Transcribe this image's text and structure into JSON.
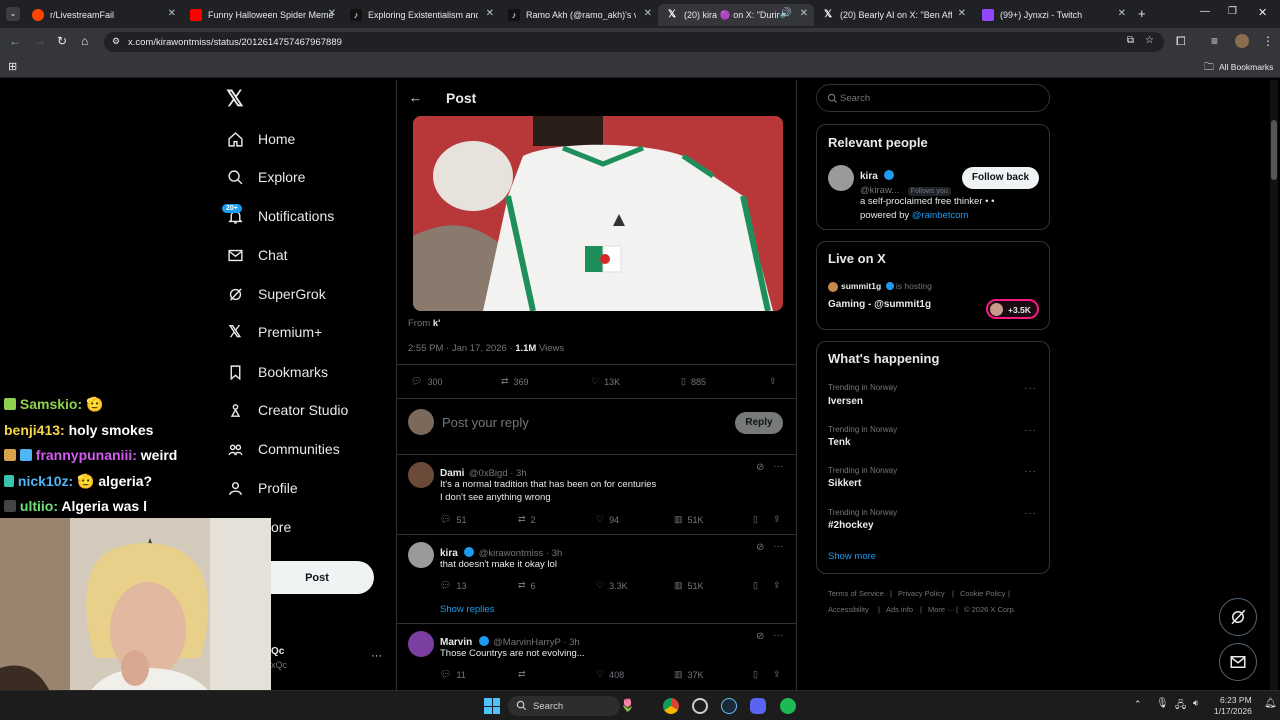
{
  "browser": {
    "tabs": [
      {
        "label": "r/LivestreamFail",
        "color": "#ff4500"
      },
      {
        "label": "Funny Halloween Spider Meme",
        "color": "#ff0000"
      },
      {
        "label": "Exploring Existentialism and Ph",
        "color": "#ffffff"
      },
      {
        "label": "Ramo Akh (@ramo_akh)'s vide",
        "color": "#ffffff"
      },
      {
        "label": "(20) kira 🟣 on X: \"During",
        "color": "#ffffff"
      },
      {
        "label": "(20) Bearly AI on X: \"Ben Affleck",
        "color": "#ffffff"
      },
      {
        "label": "(99+) Jynxzi - Twitch",
        "color": "#9146ff"
      }
    ],
    "url": "x.com/kirawontmiss/status/2012614757467967889",
    "bookmarks_label": "All Bookmarks"
  },
  "nav": {
    "items": [
      {
        "label": "Home",
        "icon": "home-icon"
      },
      {
        "label": "Explore",
        "icon": "search-icon"
      },
      {
        "label": "Notifications",
        "icon": "bell-icon",
        "badge": "20+"
      },
      {
        "label": "Chat",
        "icon": "mail-icon"
      },
      {
        "label": "SuperGrok",
        "icon": "grok-icon"
      },
      {
        "label": "Premium+",
        "icon": "x-logo-icon"
      },
      {
        "label": "Bookmarks",
        "icon": "bookmark-icon"
      },
      {
        "label": "Creator Studio",
        "icon": "creator-icon"
      },
      {
        "label": "Communities",
        "icon": "people-icon"
      },
      {
        "label": "Profile",
        "icon": "person-icon"
      },
      {
        "label": "ore",
        "icon": ""
      }
    ],
    "post_label": "Post",
    "account_fragment": "Qc",
    "account_handle_fragment": "xQc"
  },
  "post": {
    "header_title": "Post",
    "from_label": "From",
    "from_name": "k'",
    "time_line": "2:55 PM · Jan 17, 2026 · ",
    "views_count": "1.1M",
    "views_label": " Views",
    "stats": {
      "replies": "300",
      "reposts": "369",
      "likes": "13K",
      "bookmarks": "885"
    },
    "reply_placeholder": "Post your reply",
    "reply_button": "Reply"
  },
  "replies": [
    {
      "name": "Dami",
      "handle": "@0xBigd · 3h",
      "lines": [
        "It's a normal tradition that has been on for centuries",
        "I don't see anything wrong"
      ],
      "replies": "51",
      "reposts": "2",
      "likes": "94",
      "views": "51K",
      "avatar": "#6b4a3a",
      "verified": false
    },
    {
      "name": "kira",
      "handle": "@kirawontmiss · 3h",
      "lines": [
        "that doesn't make it okay lol"
      ],
      "replies": "13",
      "reposts": "6",
      "likes": "3.3K",
      "views": "51K",
      "avatar": "#9a9a9a",
      "verified": true,
      "show_replies": "Show replies"
    },
    {
      "name": "Marvin",
      "handle": "@MarvinHarryP · 3h",
      "lines": [
        "Those Countrys are not evolving..."
      ],
      "replies": "11",
      "reposts": "",
      "likes": "408",
      "views": "37K",
      "avatar": "#7a3fa0",
      "verified": true
    }
  ],
  "sidebar": {
    "search_placeholder": "Search",
    "relevant": {
      "title": "Relevant people",
      "name": "kira",
      "handle": "@kiraw...",
      "follows_you": "Follows you",
      "follow_button": "Follow back",
      "bio_line1": "a self-proclaimed free thinker • •",
      "bio_prefix": "powered by ",
      "bio_link": "@rainbetcom"
    },
    "live": {
      "title": "Live on X",
      "host": "summit1g",
      "hosting": "is hosting",
      "show": "Gaming - @summit1g",
      "listeners": "+3.5K"
    },
    "happening": {
      "title": "What's happening",
      "trends": [
        {
          "label": "Trending in Norway",
          "name": "Iversen"
        },
        {
          "label": "Trending in Norway",
          "name": "Tenk"
        },
        {
          "label": "Trending in Norway",
          "name": "Sikkert"
        },
        {
          "label": "Trending in Norway",
          "name": "#2hockey"
        }
      ],
      "show_more": "Show more"
    },
    "footer": {
      "row1": [
        "Terms of Service",
        "Privacy Policy",
        "Cookie Policy"
      ],
      "row2": [
        "Accessibility",
        "Ads info",
        "More ···",
        "© 2026 X Corp."
      ]
    }
  },
  "stream_chat": [
    {
      "user": "Samskio:",
      "msg": "🫡",
      "color": "#8fd14f"
    },
    {
      "user": "benji413:",
      "msg": "holy smokes",
      "color": "#f5d547"
    },
    {
      "user": "frannypunaniii:",
      "msg": "weird",
      "color": "#d35cf0"
    },
    {
      "user": "nick10z:",
      "msg": "🫡 algeria?",
      "color": "#4fb6f5"
    },
    {
      "user": "ultiio:",
      "msg": "Algeria was l",
      "color": "#6ee07a"
    }
  ],
  "taskbar": {
    "search_label": "Search",
    "time": "6:23 PM",
    "date": "1/17/2026"
  },
  "colors": {
    "accent": "#1d9bf0",
    "bg": "#000000",
    "border": "#2f3336",
    "muted": "#71767b"
  }
}
